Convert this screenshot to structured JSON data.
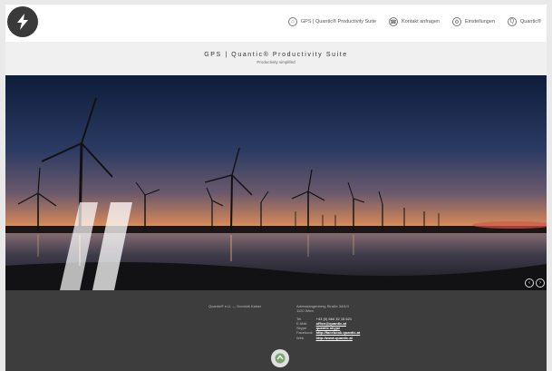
{
  "nav": {
    "items": [
      {
        "label": "GPS | Quantic® Productivity Suite",
        "icon": "home-icon"
      },
      {
        "label": "Kontakt anfragen",
        "icon": "phone-icon"
      },
      {
        "label": "Einstellungen",
        "icon": "settings-icon"
      },
      {
        "label": "Quantic®",
        "icon": "quantic-icon"
      }
    ]
  },
  "header": {
    "title": "GPS | Quantic® Productivity Suite",
    "subtitle": "Productivity simplifed"
  },
  "footer": {
    "left_text": "Quantic® e.U. — Dominik Kaiser",
    "address_line1": "Adresslangenberg Straße 34/4/4",
    "address_line2": "1120 Wien",
    "contacts": [
      {
        "label": "Tel.",
        "value": "+43 (0) 664 32 15 621"
      },
      {
        "label": "E-Mail",
        "value": "office@quantic.at"
      },
      {
        "label": "Skype",
        "value": "quantic.skype"
      },
      {
        "label": "Facebook",
        "value": "http://facebook.quantic.at"
      },
      {
        "label": "Web",
        "value": "http://www.quantic.at"
      }
    ]
  },
  "colors": {
    "footer_bg": "#3d3d3d",
    "header_bg": "#f0f0f0",
    "logo_bg": "#3a3a3a"
  }
}
